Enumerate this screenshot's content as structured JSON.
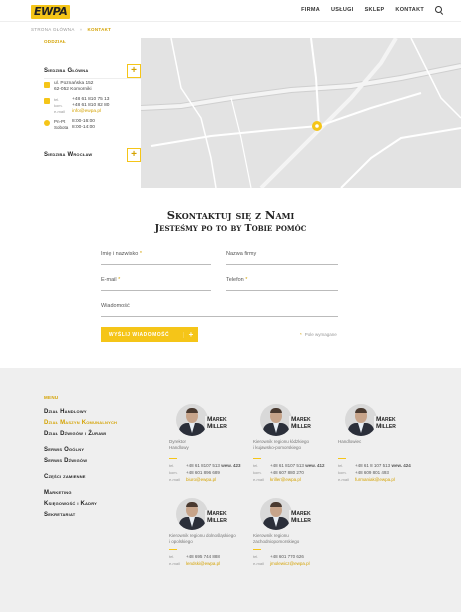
{
  "header": {
    "logo_text": "EWPA",
    "nav": [
      "Firma",
      "Usługi",
      "Sklep",
      "Kontakt"
    ],
    "search_icon": "search-icon"
  },
  "breadcrumb": {
    "home": "Strona główna",
    "separator": "»",
    "current": "Kontakt"
  },
  "offices": {
    "heading": "Oddział",
    "main": {
      "name": "Siedziba Główna",
      "street": "ul. Poznańska 152",
      "city": "62-052 Komorniki",
      "tel_label": "tel.",
      "tel": "+48 61 810 75 13",
      "kom_label": "kom.",
      "kom": "+48 61 810 82 80",
      "email_label": "e-mail",
      "email": "info@ewpa.pl",
      "hours_label_1": "Pn-Pt",
      "hours_1": "8:00-16:00",
      "hours_label_2": "Sobota",
      "hours_2": "8:00-14:00"
    },
    "second": {
      "name": "Siedziba Wrocław"
    },
    "toggle_symbol": "+"
  },
  "form": {
    "title_1": "Skontaktuj się z Nami",
    "title_2": "Jesteśmy po to by Tobie pomóc",
    "name_label": "Imię i nazwisko",
    "company_label": "Nazwa firmy",
    "email_label": "E-mail",
    "phone_label": "Telefon",
    "message_label": "Wiadomość",
    "required_mark": "*",
    "submit_label": "Wyślij wiadomość",
    "submit_plus": "+",
    "required_note": "Pole wymagane"
  },
  "footer": {
    "menu_heading": "Menu",
    "menu": [
      "Dział Handlowy",
      "Dział Maszyn Komunalnych",
      "Dział Dźwigów i Żurawi",
      "Serwis Ogólny",
      "Serwis Dźwigów",
      "Części zamienne",
      "Marketing",
      "Księgowość i Kadry",
      "Sekretariat"
    ],
    "people": [
      {
        "name_1": "Marek",
        "name_2": "Miller",
        "role_1": "Dyrektor",
        "role_2": "Handlowy",
        "tel": "+48 61 8107 513",
        "wew_label": "wew.",
        "wew": "423",
        "kom": "+48 601 896 689",
        "email": "biuro@ewpa.pl"
      },
      {
        "name_1": "Marek",
        "name_2": "Miller",
        "role_1": "Kierownik regionu łódzkiego",
        "role_2": "i kujawsko-pomorskiego",
        "tel": "+48 61 8107 513",
        "wew_label": "wew.",
        "wew": "412",
        "kom": "+48 607 880 270",
        "email": "kriller@ewpa.pl"
      },
      {
        "name_1": "Marek",
        "name_2": "Miller",
        "role_1": "Handlowiec",
        "role_2": "",
        "tel": "+48 61 8 107 513",
        "wew_label": "wew.",
        "wew": "424",
        "kom": "+48 609 801 493",
        "email": "furmaniak@ewpa.pl"
      },
      {
        "name_1": "Marek",
        "name_2": "Miller",
        "role_1": "Kierownik regionu dolnośląskiego",
        "role_2": "i opolskiego",
        "tel": "+48 695 744 888",
        "wew_label": "",
        "wew": "",
        "kom": "",
        "email": "lendski@ewpa.pl"
      },
      {
        "name_1": "Marek",
        "name_2": "Miller",
        "role_1": "Kierownik regionu",
        "role_2": "zachodniopomorskiego",
        "tel": "+48 601 770 626",
        "wew_label": "",
        "wew": "",
        "kom": "",
        "email": "jmolewicz@ewpa.pl"
      }
    ],
    "contact_labels": {
      "tel": "tel.",
      "kom": "kom.",
      "email": "e-mail"
    }
  },
  "colors": {
    "accent": "#f5c518",
    "accent_text": "#d4a200",
    "footer_bg": "#efefef"
  }
}
